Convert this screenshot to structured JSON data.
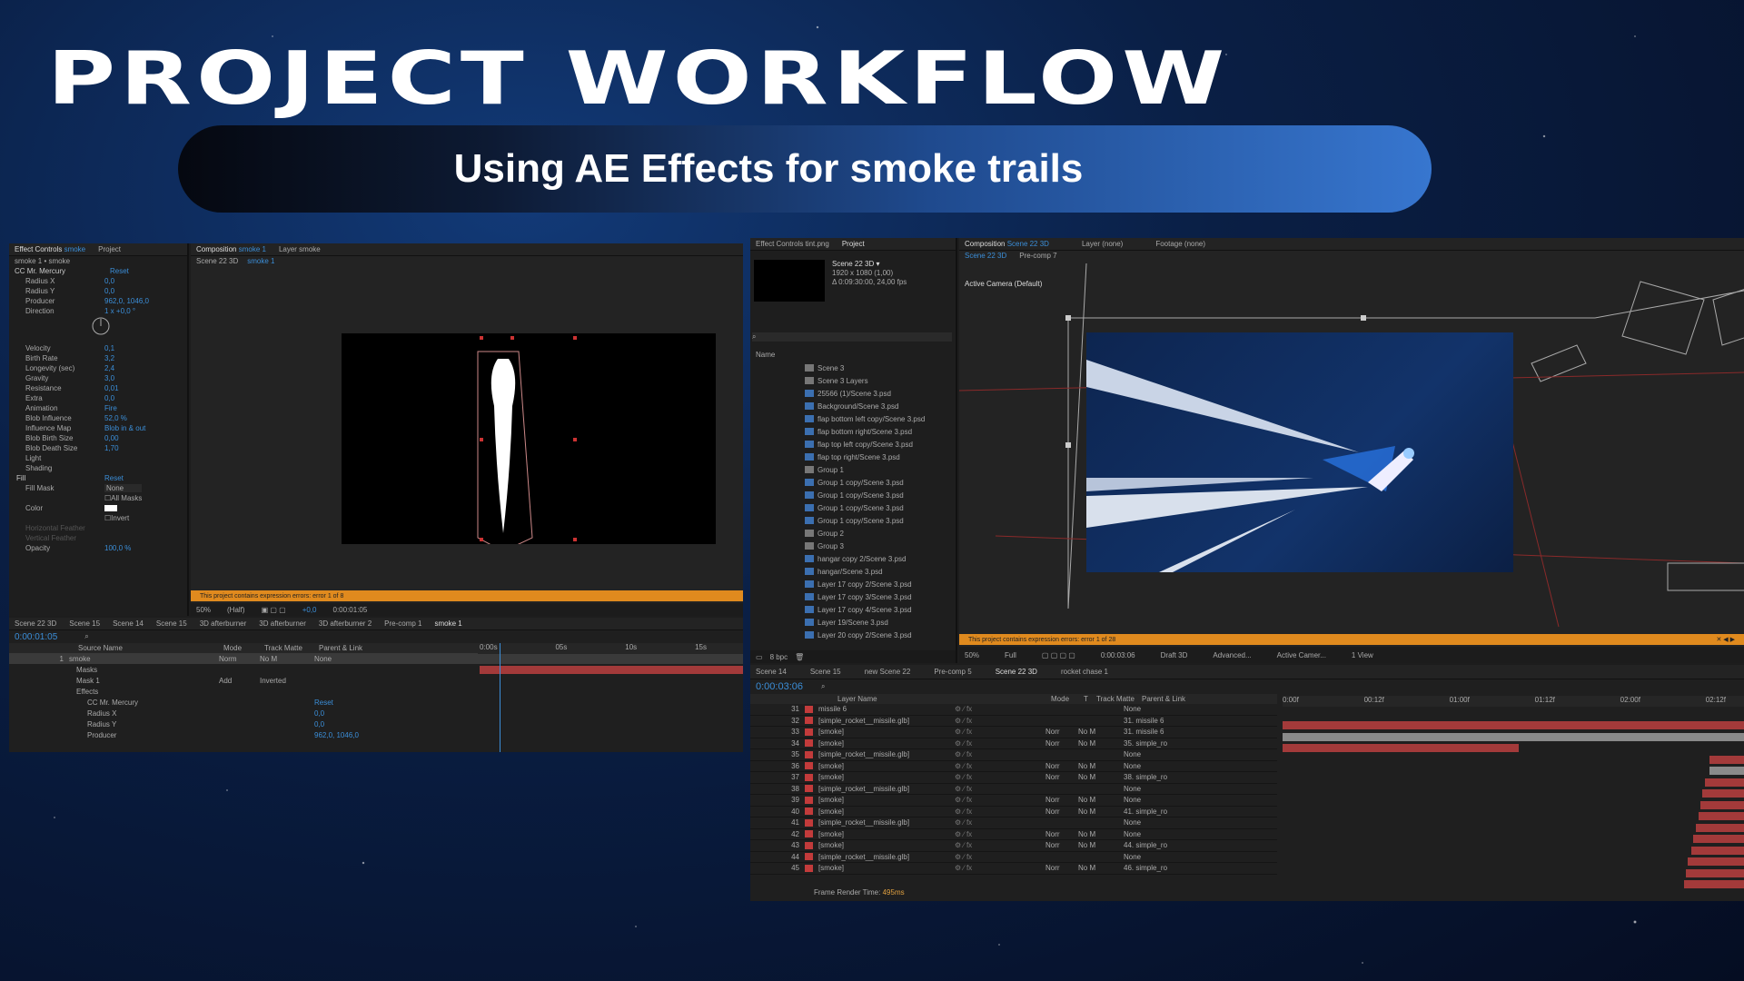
{
  "slide": {
    "title": "PROJECT WORKFLOW",
    "subtitle": "Using AE Effects for smoke trails"
  },
  "colors": {
    "accent": "#3776cf",
    "warning": "#e08a1e",
    "layer_red": "#c23b3b",
    "ae_blue": "#3b8ed8"
  },
  "left": {
    "effect_tab": "Effect Controls",
    "effect_target": "smoke",
    "project_tab": "Project",
    "comp_tab": "Composition",
    "comp_name": "smoke 1",
    "layer_tab": "Layer smoke",
    "breadcrumb": [
      "Scene 22 3D",
      "smoke 1"
    ],
    "layer_path": "smoke 1 • smoke",
    "effect_name": "CC Mr. Mercury",
    "reset": "Reset",
    "props": [
      {
        "name": "Radius X",
        "value": "0,0"
      },
      {
        "name": "Radius Y",
        "value": "0,0"
      },
      {
        "name": "Producer",
        "value": "962,0, 1046,0"
      },
      {
        "name": "Direction",
        "value": "1 x +0,0 °"
      },
      {
        "name": "Velocity",
        "value": "0,1"
      },
      {
        "name": "Birth Rate",
        "value": "3,2"
      },
      {
        "name": "Longevity (sec)",
        "value": "2,4"
      },
      {
        "name": "Gravity",
        "value": "3,0"
      },
      {
        "name": "Resistance",
        "value": "0,01"
      },
      {
        "name": "Extra",
        "value": "0,0"
      },
      {
        "name": "Animation",
        "value": "Fire"
      },
      {
        "name": "Blob Influence",
        "value": "52,0 %"
      },
      {
        "name": "Influence Map",
        "value": "Blob in & out"
      },
      {
        "name": "Blob Birth Size",
        "value": "0,00"
      },
      {
        "name": "Blob Death Size",
        "value": "1,70"
      },
      {
        "name": "Light",
        "value": ""
      },
      {
        "name": "Shading",
        "value": ""
      }
    ],
    "fill": {
      "name": "Fill",
      "reset": "Reset",
      "fill_mask": "Fill Mask",
      "fill_mask_value": "None",
      "all_masks": "All Masks",
      "color": "Color",
      "invert": "Invert",
      "h_feather": "Horizontal Feather",
      "v_feather": "Vertical Feather",
      "opacity": "Opacity",
      "opacity_value": "100,0 %"
    },
    "warning": "This project contains expression errors: error 1 of 8",
    "viewer": {
      "zoom": "50%",
      "res": "(Half)",
      "exposure": "+0,0",
      "time": "0:00:01:05"
    },
    "tl_tabs": [
      "Scene 22 3D",
      "Scene 15",
      "Scene 14",
      "Scene 15",
      "3D afterburner",
      "3D afterburner",
      "3D afterburner 2",
      "Pre-comp 1",
      "smoke 1"
    ],
    "timecode": "0:00:01:05",
    "tl_headers": {
      "source": "Source Name",
      "mode": "Mode",
      "track": "Track Matte",
      "parent": "Parent & Link"
    },
    "tl_rows": [
      {
        "num": "1",
        "name": "smoke",
        "mode": "Norm",
        "matte": "No M",
        "parent": "None"
      },
      {
        "name": "Masks"
      },
      {
        "name": "Mask 1",
        "mode": "Add",
        "matte": "Inverted"
      },
      {
        "name": "Effects"
      },
      {
        "name": "CC Mr. Mercury",
        "parent": "Reset"
      },
      {
        "name": "Radius X",
        "parent": "0,0"
      },
      {
        "name": "Radius Y",
        "parent": "0,0"
      },
      {
        "name": "Producer",
        "parent": "962,0, 1046,0"
      }
    ],
    "ruler": [
      "0:00s",
      "05s",
      "10s",
      "15s"
    ]
  },
  "right": {
    "effect_tab": "Effect Controls",
    "effect_target": "tint.png",
    "project_tab": "Project",
    "comp_tab": "Composition",
    "comp_name": "Scene 22 3D",
    "layer_tab": "Layer (none)",
    "footage_tab": "Footage (none)",
    "breadcrumb": [
      "Scene 22 3D",
      "Pre-comp 7"
    ],
    "active_camera": "Active Camera (Default)",
    "comp_info": {
      "name": "Scene 22 3D ▾",
      "size": "1920 x 1080 (1,00)",
      "duration": "Δ 0:09:30:00, 24,00 fps"
    },
    "name_header": "Name",
    "files": [
      "Scene 3",
      "Scene 3 Layers",
      "25566 (1)/Scene 3.psd",
      "Background/Scene 3.psd",
      "flap bottom left copy/Scene 3.psd",
      "flap bottom right/Scene 3.psd",
      "flap top left copy/Scene 3.psd",
      "flap top right/Scene 3.psd",
      "Group 1",
      "Group 1 copy/Scene 3.psd",
      "Group 1 copy/Scene 3.psd",
      "Group 1 copy/Scene 3.psd",
      "Group 1 copy/Scene 3.psd",
      "Group 2",
      "Group 3",
      "hangar copy 2/Scene 3.psd",
      "hangar/Scene 3.psd",
      "Layer 17 copy 2/Scene 3.psd",
      "Layer 17 copy 3/Scene 3.psd",
      "Layer 17 copy 4/Scene 3.psd",
      "Layer 19/Scene 3.psd",
      "Layer 20 copy 2/Scene 3.psd"
    ],
    "bpc": "8 bpc",
    "warning": "This project contains expression errors: error 1 of 28",
    "viewer": {
      "zoom": "50%",
      "res": "Full",
      "time": "0:00:03:06",
      "renderer": "Draft 3D",
      "advanced": "Advanced...",
      "camera": "Active Camer...",
      "view": "1 View"
    },
    "tl_tabs": [
      "Scene 14",
      "Scene 15",
      "new Scene 22",
      "Pre-comp 5",
      "Scene 22 3D",
      "rocket chase 1"
    ],
    "timecode": "0:00:03:06",
    "tl_headers": {
      "layer": "Layer Name",
      "mode": "Mode",
      "t": "T",
      "track": "Track Matte",
      "parent": "Parent & Link"
    },
    "ruler": [
      "0:00f",
      "00:12f",
      "01:00f",
      "01:12f",
      "02:00f",
      "02:12f"
    ],
    "layers": [
      {
        "num": "31",
        "name": "missile 6",
        "mode": "",
        "matte": "",
        "parent": "None",
        "color": "#c23b3b"
      },
      {
        "num": "32",
        "name": "[simple_rocket__missile.glb]",
        "mode": "",
        "matte": "",
        "parent": "31. missile 6",
        "color": "#c23b3b"
      },
      {
        "num": "33",
        "name": "[smoke]",
        "mode": "Norr",
        "matte": "No M",
        "parent": "31. missile 6",
        "color": "#c23b3b"
      },
      {
        "num": "34",
        "name": "[smoke]",
        "mode": "Norr",
        "matte": "No M",
        "parent": "35. simple_ro",
        "color": "#c23b3b"
      },
      {
        "num": "35",
        "name": "[simple_rocket__missile.glb]",
        "mode": "",
        "matte": "",
        "parent": "None",
        "color": "#c23b3b"
      },
      {
        "num": "36",
        "name": "[smoke]",
        "mode": "Norr",
        "matte": "No M",
        "parent": "None",
        "color": "#c23b3b"
      },
      {
        "num": "37",
        "name": "[smoke]",
        "mode": "Norr",
        "matte": "No M",
        "parent": "38. simple_ro",
        "color": "#c23b3b"
      },
      {
        "num": "38",
        "name": "[simple_rocket__missile.glb]",
        "mode": "",
        "matte": "",
        "parent": "None",
        "color": "#c23b3b"
      },
      {
        "num": "39",
        "name": "[smoke]",
        "mode": "Norr",
        "matte": "No M",
        "parent": "None",
        "color": "#c23b3b"
      },
      {
        "num": "40",
        "name": "[smoke]",
        "mode": "Norr",
        "matte": "No M",
        "parent": "41. simple_ro",
        "color": "#c23b3b"
      },
      {
        "num": "41",
        "name": "[simple_rocket__missile.glb]",
        "mode": "",
        "matte": "",
        "parent": "None",
        "color": "#c23b3b"
      },
      {
        "num": "42",
        "name": "[smoke]",
        "mode": "Norr",
        "matte": "No M",
        "parent": "None",
        "color": "#c23b3b"
      },
      {
        "num": "43",
        "name": "[smoke]",
        "mode": "Norr",
        "matte": "No M",
        "parent": "44. simple_ro",
        "color": "#c23b3b"
      },
      {
        "num": "44",
        "name": "[simple_rocket__missile.glb]",
        "mode": "",
        "matte": "",
        "parent": "None",
        "color": "#c23b3b"
      },
      {
        "num": "45",
        "name": "[smoke]",
        "mode": "Norr",
        "matte": "No M",
        "parent": "46. simple_ro",
        "color": "#c23b3b"
      }
    ],
    "frame_render": "Frame Render Time:",
    "frame_render_value": "495ms"
  }
}
